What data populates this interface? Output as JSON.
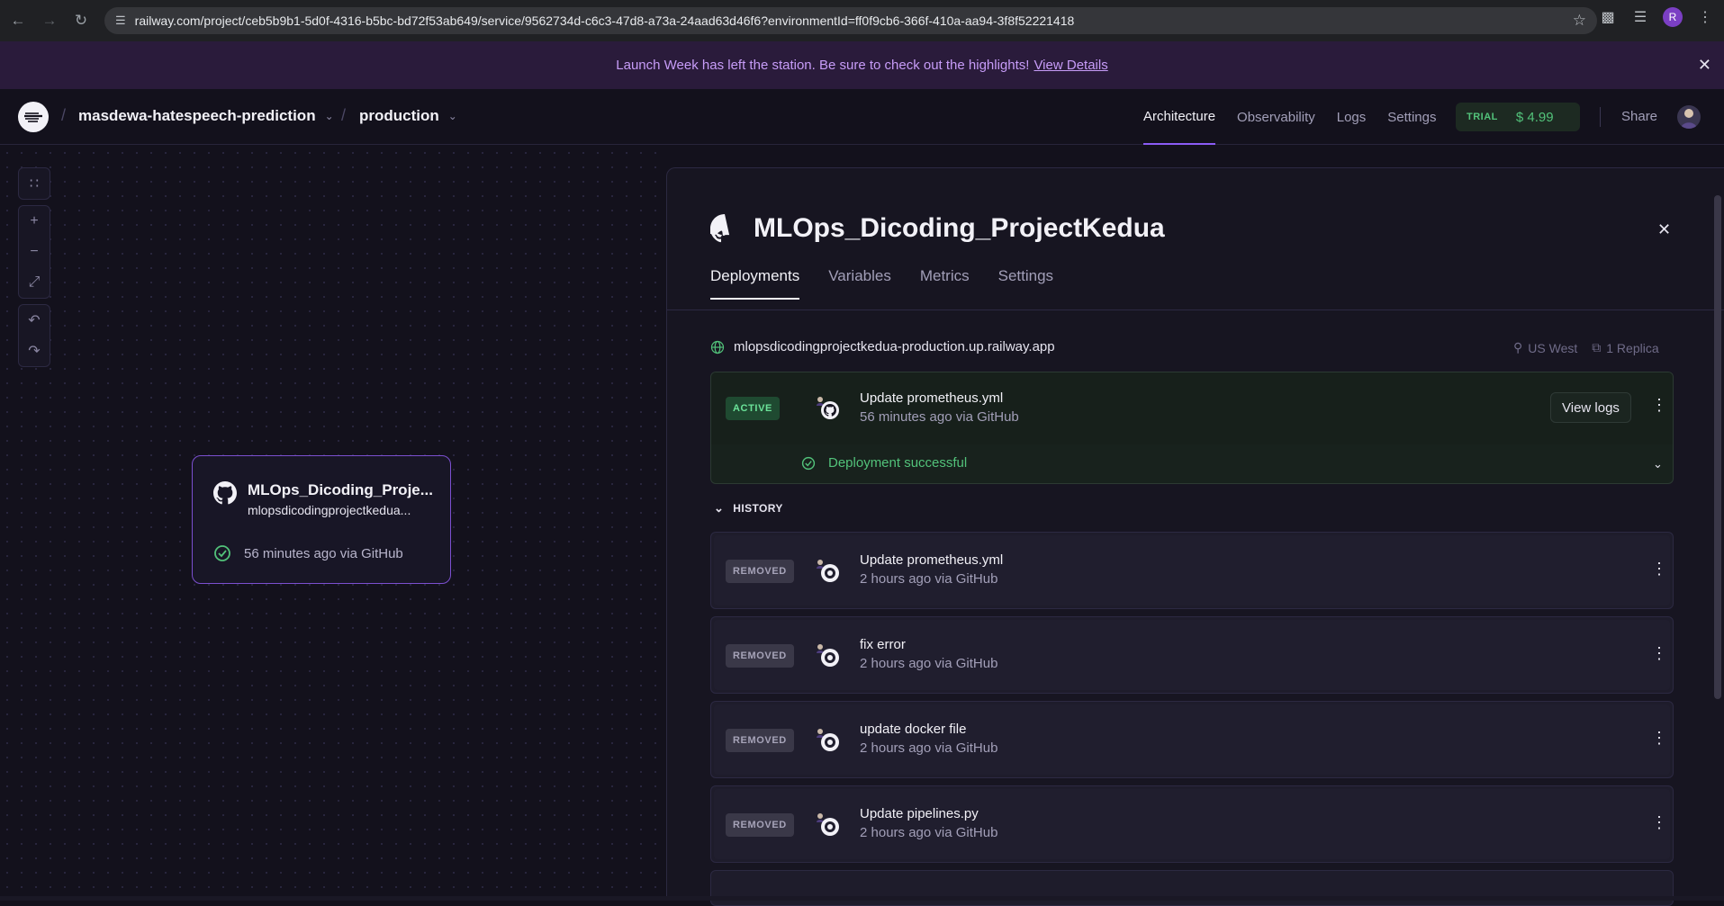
{
  "browser": {
    "url": "railway.com/project/ceb5b9b1-5d0f-4316-b5bc-bd72f53ab649/service/9562734d-c6c3-47d8-a73a-24aad63d46f6?environmentId=ff0f9cb6-366f-410a-aa94-3f8f52221418",
    "profile_initial": "R"
  },
  "banner": {
    "text": "Launch Week has left the station. Be sure to check out the highlights!",
    "link": "View Details"
  },
  "header": {
    "project": "masdewa-hatespeech-prediction",
    "environment": "production",
    "nav": [
      "Architecture",
      "Observability",
      "Logs",
      "Settings"
    ],
    "active_nav": "Architecture",
    "trial_label": "TRIAL",
    "trial_credit": "$ 4.99",
    "share": "Share"
  },
  "canvas": {
    "service_card": {
      "title": "MLOps_Dicoding_Proje...",
      "domain": "mlopsdicodingprojectkedua...",
      "status": "56 minutes ago via GitHub"
    }
  },
  "panel": {
    "title": "MLOps_Dicoding_ProjectKedua",
    "tabs": [
      "Deployments",
      "Variables",
      "Metrics",
      "Settings"
    ],
    "domain": "mlopsdicodingprojectkedua-production.up.railway.app",
    "region": "US West",
    "replicas": "1 Replica",
    "active": {
      "badge": "ACTIVE",
      "message": "Update prometheus.yml",
      "when": "56 minutes ago via GitHub",
      "view_logs": "View logs",
      "status": "Deployment successful"
    },
    "history_label": "HISTORY",
    "history": [
      {
        "badge": "REMOVED",
        "message": "Update prometheus.yml",
        "when": "2 hours ago via GitHub"
      },
      {
        "badge": "REMOVED",
        "message": "fix error",
        "when": "2 hours ago via GitHub"
      },
      {
        "badge": "REMOVED",
        "message": "update docker file",
        "when": "2 hours ago via GitHub"
      },
      {
        "badge": "REMOVED",
        "message": "Update pipelines.py",
        "when": "2 hours ago via GitHub"
      }
    ]
  },
  "colors": {
    "accent": "#8b5cf6",
    "success": "#52c27a",
    "banner_text": "#c79cf8"
  }
}
